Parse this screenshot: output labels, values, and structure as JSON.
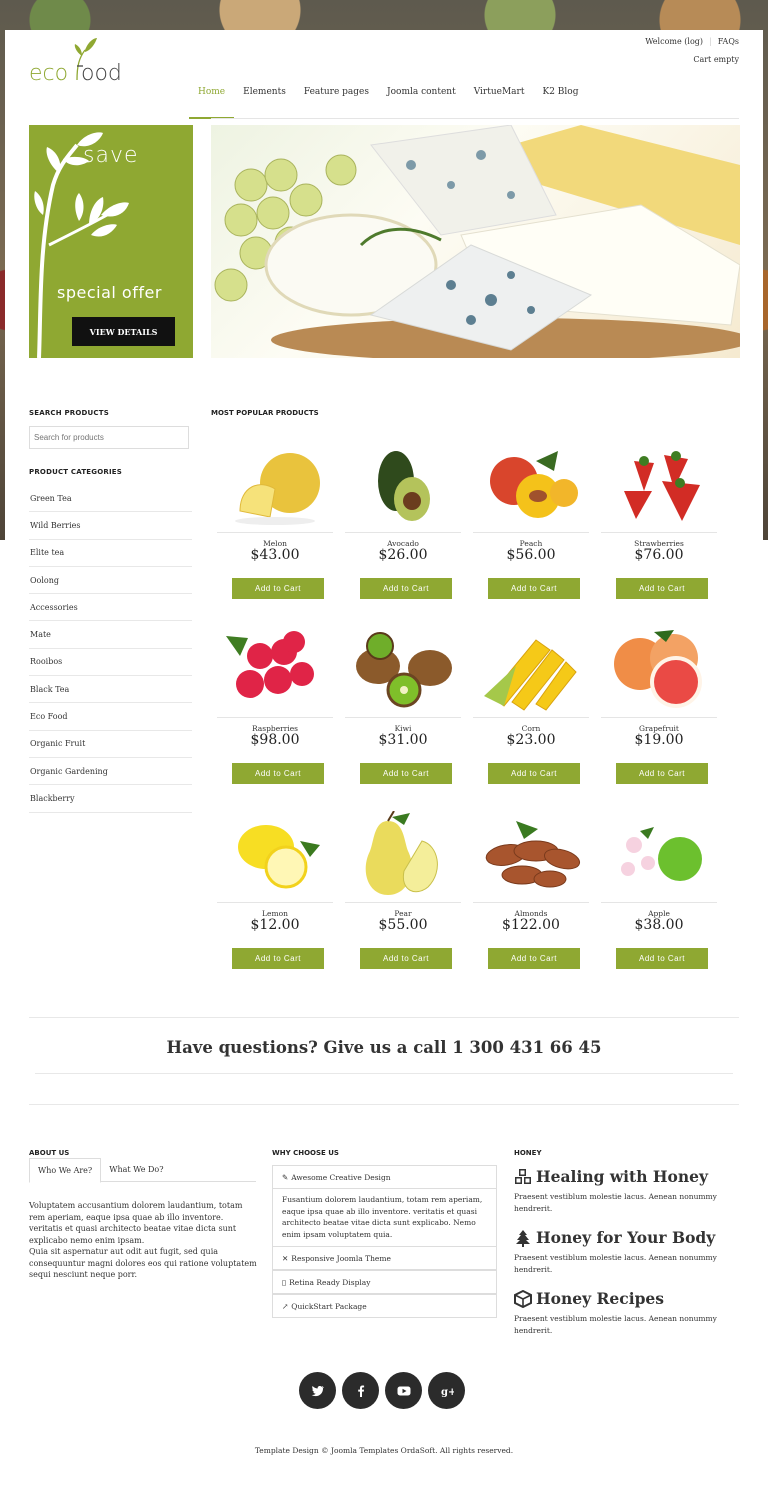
{
  "brand": {
    "logo_text": "ecofood",
    "accent": "#8fa832"
  },
  "header": {
    "welcome": "Welcome (log)",
    "faqs": "FAQs",
    "cart": "Cart empty",
    "nav": [
      "Home",
      "Elements",
      "Feature pages",
      "Joomla content",
      "VirtueMart",
      "K2 Blog"
    ]
  },
  "promo": {
    "title": "save",
    "subtitle": "special offer",
    "button": "VIEW DETAILS"
  },
  "sidebar": {
    "search_title": "SEARCH PRODUCTS",
    "search_placeholder": "Search for products",
    "categories_title": "PRODUCT CATEGORIES",
    "categories": [
      "Green Tea",
      "Wild Berries",
      "Elite tea",
      "Oolong",
      "Accessories",
      "Mate",
      "Rooibos",
      "Black Tea",
      "Eco Food",
      "Organic Fruit",
      "Organic Gardening",
      "Blackberry"
    ]
  },
  "products": {
    "title": "MOST POPULAR PRODUCTS",
    "add_label": "Add to Cart",
    "items": [
      {
        "name": "Melon",
        "price": "$43.00",
        "icon": "melon-image"
      },
      {
        "name": "Avocado",
        "price": "$26.00",
        "icon": "avocado-image"
      },
      {
        "name": "Peach",
        "price": "$56.00",
        "icon": "peach-image"
      },
      {
        "name": "Strawberries",
        "price": "$76.00",
        "icon": "strawberries-image"
      },
      {
        "name": "Raspberries",
        "price": "$98.00",
        "icon": "raspberries-image"
      },
      {
        "name": "Kiwi",
        "price": "$31.00",
        "icon": "kiwi-image"
      },
      {
        "name": "Corn",
        "price": "$23.00",
        "icon": "corn-image"
      },
      {
        "name": "Grapefruit",
        "price": "$19.00",
        "icon": "grapefruit-image"
      },
      {
        "name": "Lemon",
        "price": "$12.00",
        "icon": "lemon-image"
      },
      {
        "name": "Pear",
        "price": "$55.00",
        "icon": "pear-image"
      },
      {
        "name": "Almonds",
        "price": "$122.00",
        "icon": "almonds-image"
      },
      {
        "name": "Apple",
        "price": "$38.00",
        "icon": "apple-image"
      }
    ]
  },
  "call": "Have questions? Give us a call 1 300 431 66 45",
  "about": {
    "title": "ABOUT US",
    "tabs": [
      "Who We Are?",
      "What We Do?"
    ],
    "text1": "Voluptatem accusantium dolorem laudantium, totam rem aperiam, eaque ipsa quae ab illo inventore. veritatis et quasi architecto beatae vitae dicta sunt explicabo nemo enim ipsam.",
    "text2": "Quia sit aspernatur aut odit aut fugit, sed quia consequuntur magni dolores eos qui ratione voluptatem sequi nesciunt neque porr."
  },
  "why": {
    "title": "WHY CHOOSE US",
    "items": [
      "Awesome Creative Design",
      "Responsive Joomla Theme",
      "Retina Ready Display",
      "QuickStart Package"
    ],
    "body": "Fusantium dolorem laudantium, totam rem aperiam, eaque ipsa quae ab illo inventore. veritatis et quasi architecto beatae vitae dicta sunt explicabo. Nemo enim ipsam voluptatem quia."
  },
  "honey": {
    "title": "HONEY",
    "items": [
      {
        "heading": "Healing with Honey",
        "text": "Praesent vestiblum molestie lacus. Aenean nonummy hendrerit.",
        "icon": "cubes-icon"
      },
      {
        "heading": "Honey for Your Body",
        "text": "Praesent vestiblum molestie lacus. Aenean nonummy hendrerit.",
        "icon": "tree-icon"
      },
      {
        "heading": "Honey Recipes",
        "text": "Praesent vestiblum molestie lacus. Aenean nonummy hendrerit.",
        "icon": "cube-icon"
      }
    ]
  },
  "social": [
    "twitter-icon",
    "facebook-icon",
    "youtube-icon",
    "google-plus-icon"
  ],
  "copyright": "Template Design © Joomla Templates OrdaSoft. All rights reserved."
}
